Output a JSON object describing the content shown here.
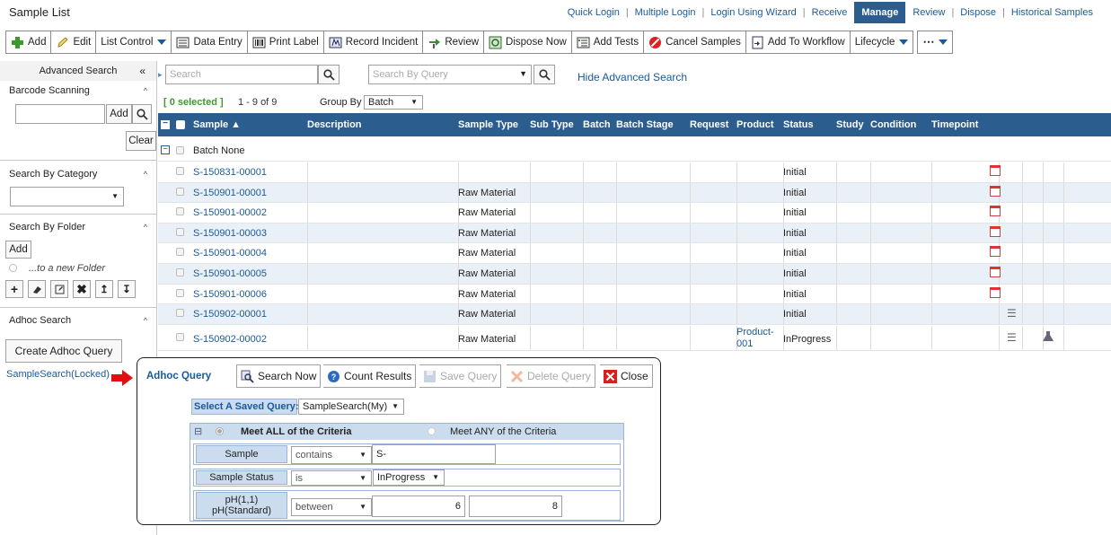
{
  "header": {
    "title": "Sample List",
    "nav": [
      "Quick Login",
      "Multiple Login",
      "Login Using Wizard",
      "Receive",
      "Manage",
      "Review",
      "Dispose",
      "Historical Samples"
    ],
    "active": "Manage"
  },
  "toolbar": {
    "add": "Add",
    "edit": "Edit",
    "list_control": "List Control",
    "data_entry": "Data Entry",
    "print_label": "Print Label",
    "record_incident": "Record Incident",
    "review": "Review",
    "dispose_now": "Dispose Now",
    "add_tests": "Add Tests",
    "cancel_samples": "Cancel Samples",
    "add_to_workflow": "Add To Workflow",
    "lifecycle": "Lifecycle",
    "more": "⋯"
  },
  "sidebar": {
    "advanced_search": "Advanced Search",
    "collapse": "«",
    "barcode": "Barcode Scanning",
    "add": "Add",
    "clear": "Clear",
    "by_category": "Search By Category",
    "by_folder": "Search By Folder",
    "folder_add": "Add",
    "new_folder": "...to a new Folder",
    "adhoc": "Adhoc Search",
    "create_query": "Create Adhoc Query",
    "saved_link": "SampleSearch(Locked)"
  },
  "search": {
    "placeholder": "Search",
    "query_placeholder": "Search By Query",
    "hide_advanced": "Hide Advanced Search"
  },
  "status": {
    "selected": "[ 0 selected ]",
    "range": "1 - 9 of 9",
    "group_by_label": "Group By",
    "group_by_value": "Batch"
  },
  "grid": {
    "columns": [
      "Sample ▲",
      "Description",
      "Sample Type",
      "Sub Type",
      "Batch",
      "Batch Stage",
      "Request",
      "Product",
      "Status",
      "Study",
      "Condition",
      "Timepoint"
    ],
    "group": "Batch None",
    "rows": [
      {
        "id": "S-150831-00001",
        "type": "",
        "product": "",
        "status": "Initial",
        "icon": "calendar"
      },
      {
        "id": "S-150901-00001",
        "type": "Raw Material",
        "product": "",
        "status": "Initial",
        "icon": "calendar"
      },
      {
        "id": "S-150901-00002",
        "type": "Raw Material",
        "product": "",
        "status": "Initial",
        "icon": "calendar"
      },
      {
        "id": "S-150901-00003",
        "type": "Raw Material",
        "product": "",
        "status": "Initial",
        "icon": "calendar"
      },
      {
        "id": "S-150901-00004",
        "type": "Raw Material",
        "product": "",
        "status": "Initial",
        "icon": "calendar"
      },
      {
        "id": "S-150901-00005",
        "type": "Raw Material",
        "product": "",
        "status": "Initial",
        "icon": "calendar"
      },
      {
        "id": "S-150901-00006",
        "type": "Raw Material",
        "product": "",
        "status": "Initial",
        "icon": "calendar"
      },
      {
        "id": "S-150902-00001",
        "type": "Raw Material",
        "product": "",
        "status": "Initial",
        "icon": "list"
      },
      {
        "id": "S-150902-00002",
        "type": "Raw Material",
        "product": "Product-\n001",
        "status": "InProgress",
        "icon": "list"
      }
    ]
  },
  "adhoc": {
    "title": "Adhoc Query",
    "search_now": "Search Now",
    "count_results": "Count Results",
    "save_query": "Save Query",
    "delete_query": "Delete Query",
    "close": "Close",
    "saved_label": "Select A Saved Query:",
    "saved_value": "SampleSearch(My)",
    "meet_all": "Meet ALL of the Criteria",
    "meet_any": "Meet ANY of the Criteria",
    "criteria": [
      {
        "label": "Sample",
        "op": "contains",
        "value": "S-"
      },
      {
        "label": "Sample Status",
        "op": "is",
        "value": "InProgress"
      },
      {
        "label": "pH(1,1)\npH(Standard)",
        "op": "between",
        "value": "6",
        "value2": "8"
      }
    ]
  }
}
